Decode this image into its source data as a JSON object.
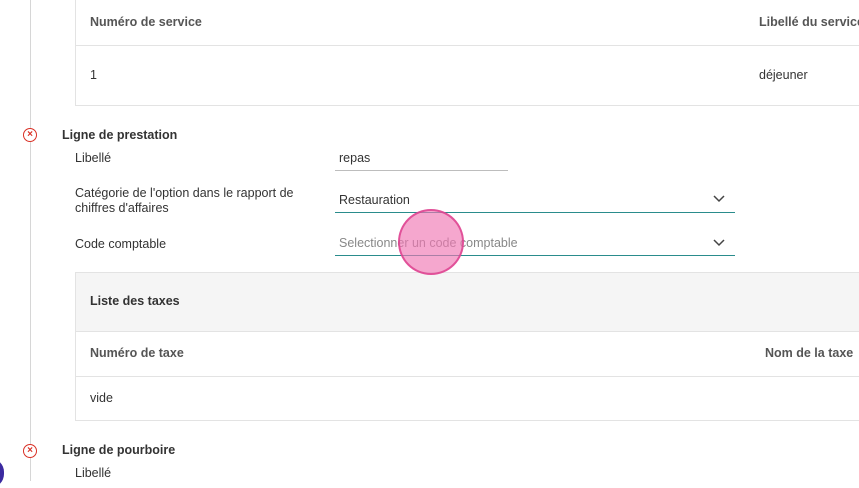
{
  "service_table": {
    "headers": [
      "Numéro de service",
      "Libellé du service"
    ],
    "rows": [
      [
        "1",
        "déjeuner"
      ]
    ]
  },
  "prestation": {
    "title": "Ligne de prestation",
    "libelle_label": "Libellé",
    "libelle_value": "repas",
    "categorie_label_line1": "Catégorie de l'option dans le rapport de",
    "categorie_label_line2": "chiffres d'affaires",
    "categorie_value": "Restauration",
    "code_label": "Code comptable",
    "code_placeholder": "Selectionner un code comptable"
  },
  "taxes": {
    "title": "Liste des taxes",
    "headers": [
      "Numéro de taxe",
      "Nom de la taxe"
    ],
    "empty_value": "vide"
  },
  "pourboire": {
    "title": "Ligne de pourboire",
    "libelle_label": "Libellé"
  },
  "icons": {
    "error": "close-circle-icon",
    "chevron": "chevron-down-icon"
  },
  "colors": {
    "error": "#d93025",
    "focus_underline": "#2a8c8c",
    "cursor_highlight": "#f078b4"
  }
}
